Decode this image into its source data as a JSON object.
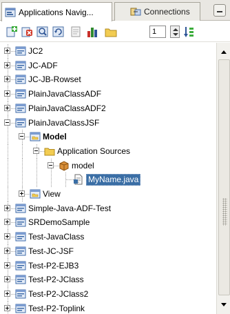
{
  "tabs": [
    {
      "label": "Applications Navig...",
      "icon": "applications-navigator-icon",
      "active": true
    },
    {
      "label": "Connections",
      "icon": "connections-icon",
      "active": false
    }
  ],
  "toolbar": {
    "buttons": [
      "new-application-icon",
      "delete-icon",
      "find-icon",
      "refresh-icon",
      "properties-icon",
      "chart-icon",
      "folder-icon"
    ],
    "level_value": "1",
    "sort_icon": "sort-icon"
  },
  "tree": {
    "items": [
      {
        "label": "JC2",
        "level": 0,
        "expander": "plus",
        "icon": "project-icon",
        "bold": false,
        "selected": false
      },
      {
        "label": "JC-ADF",
        "level": 0,
        "expander": "plus",
        "icon": "project-icon",
        "bold": false,
        "selected": false
      },
      {
        "label": "JC-JB-Rowset",
        "level": 0,
        "expander": "plus",
        "icon": "project-icon",
        "bold": false,
        "selected": false
      },
      {
        "label": "PlainJavaClassADF",
        "level": 0,
        "expander": "plus",
        "icon": "project-icon",
        "bold": false,
        "selected": false
      },
      {
        "label": "PlainJavaClassADF2",
        "level": 0,
        "expander": "plus",
        "icon": "project-icon",
        "bold": false,
        "selected": false
      },
      {
        "label": "PlainJavaClassJSF",
        "level": 0,
        "expander": "minus",
        "icon": "project-icon",
        "bold": false,
        "selected": false
      },
      {
        "label": "Model",
        "level": 1,
        "expander": "minus",
        "icon": "module-icon",
        "bold": true,
        "selected": false
      },
      {
        "label": "Application Sources",
        "level": 2,
        "expander": "minus",
        "icon": "folder-icon",
        "bold": false,
        "selected": false
      },
      {
        "label": "model",
        "level": 3,
        "expander": "minus",
        "icon": "package-icon",
        "bold": false,
        "selected": false
      },
      {
        "label": "MyName.java",
        "level": 4,
        "expander": "none",
        "icon": "java-file-icon",
        "bold": false,
        "selected": true
      },
      {
        "label": "View",
        "level": 1,
        "expander": "plus",
        "icon": "module-icon",
        "bold": false,
        "selected": false
      },
      {
        "label": "Simple-Java-ADF-Test",
        "level": 0,
        "expander": "plus",
        "icon": "project-icon",
        "bold": false,
        "selected": false
      },
      {
        "label": "SRDemoSample",
        "level": 0,
        "expander": "plus",
        "icon": "project-icon",
        "bold": false,
        "selected": false
      },
      {
        "label": "Test-JavaClass",
        "level": 0,
        "expander": "plus",
        "icon": "project-icon",
        "bold": false,
        "selected": false
      },
      {
        "label": "Test-JC-JSF",
        "level": 0,
        "expander": "plus",
        "icon": "project-icon",
        "bold": false,
        "selected": false
      },
      {
        "label": "Test-P2-EJB3",
        "level": 0,
        "expander": "plus",
        "icon": "project-icon",
        "bold": false,
        "selected": false
      },
      {
        "label": "Test-P2-JClass",
        "level": 0,
        "expander": "plus",
        "icon": "project-icon",
        "bold": false,
        "selected": false
      },
      {
        "label": "Test-P2-JClass2",
        "level": 0,
        "expander": "plus",
        "icon": "project-icon",
        "bold": false,
        "selected": false
      },
      {
        "label": "Test-P2-Toplink",
        "level": 0,
        "expander": "plus",
        "icon": "project-icon",
        "bold": false,
        "selected": false
      }
    ]
  },
  "colors": {
    "selection": "#3a6ea5",
    "tab_background": "#e9e7e2"
  }
}
